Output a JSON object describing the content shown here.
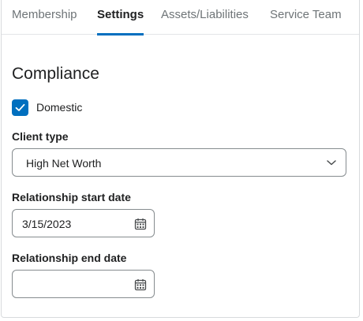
{
  "tabs": [
    {
      "label": "Membership",
      "active": false
    },
    {
      "label": "Settings",
      "active": true
    },
    {
      "label": "Assets/Liabilities",
      "active": false
    },
    {
      "label": "Service Team",
      "active": false
    }
  ],
  "section": {
    "title": "Compliance"
  },
  "domestic": {
    "label": "Domestic",
    "checked": true
  },
  "client_type": {
    "label": "Client type",
    "value": "High Net Worth",
    "icon": "chevron-down-icon"
  },
  "start_date": {
    "label": "Relationship start date",
    "value": "3/15/2023",
    "icon": "calendar-icon"
  },
  "end_date": {
    "label": "Relationship end date",
    "value": "",
    "icon": "calendar-icon"
  },
  "colors": {
    "accent": "#006fbf",
    "border": "#868c8f",
    "text": "#202122",
    "muted_tab": "#6e7477"
  }
}
